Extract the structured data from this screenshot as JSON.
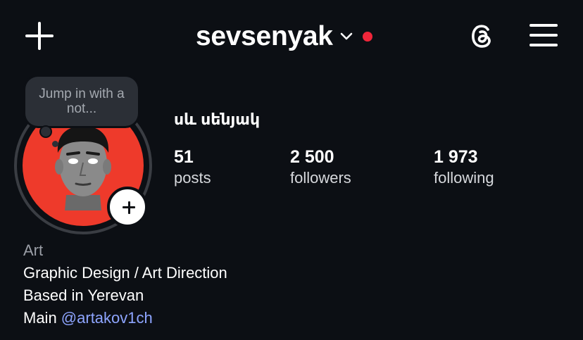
{
  "header": {
    "username": "sevsenyak",
    "icons": {
      "create": "plus-icon",
      "switch_account": "chevron-down-icon",
      "notification": "red-dot-icon",
      "threads": "threads-icon",
      "menu": "hamburger-menu-icon"
    },
    "notification_color": "#f0263a"
  },
  "profile": {
    "note": "Jump in with a not...",
    "display_name": "սև սենյակ",
    "avatar_bg": "#ee3a2b",
    "stats": {
      "posts": {
        "value": "51",
        "label": "posts"
      },
      "followers": {
        "value": "2 500",
        "label": "followers"
      },
      "following": {
        "value": "1 973",
        "label": "following"
      }
    }
  },
  "bio": {
    "category": "Art",
    "line1": "Graphic Design / Art Direction",
    "line2": "Based in Yerevan",
    "line3_prefix": "Main ",
    "mention": "@artakov1ch",
    "mention_color": "#8ea5ff"
  }
}
